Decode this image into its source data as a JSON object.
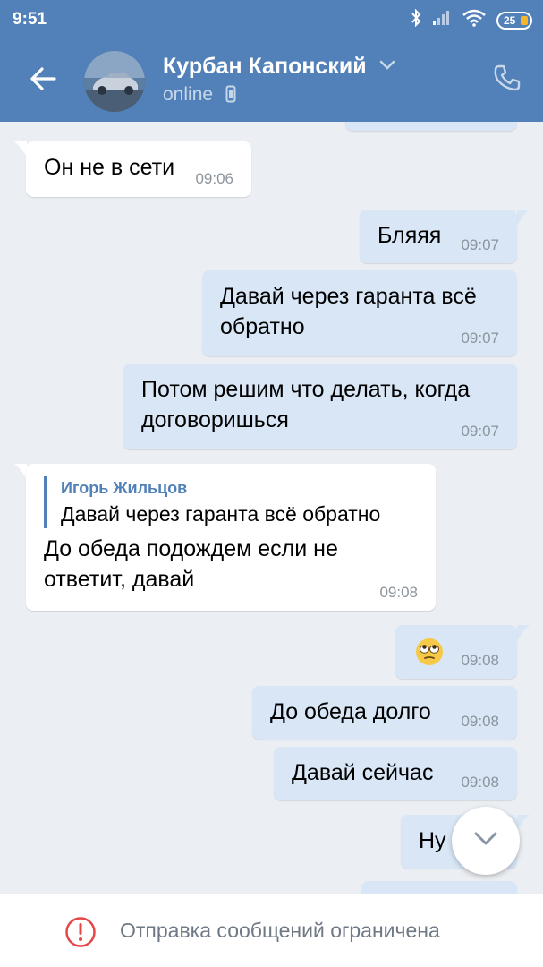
{
  "status_bar": {
    "time": "9:51",
    "battery": "25",
    "icons": [
      "bluetooth-icon",
      "signal-icon",
      "wifi-icon",
      "battery-icon"
    ]
  },
  "header": {
    "contact_name": "Курбан Капонский",
    "status": "online",
    "icons": [
      "back-arrow-icon",
      "chevron-down-icon",
      "mobile-icon",
      "phone-icon"
    ]
  },
  "messages": [
    {
      "direction": "in",
      "text": "Он не в сети",
      "time": "09:06"
    },
    {
      "direction": "out",
      "text": "Бляяя",
      "time": "09:07"
    },
    {
      "direction": "out",
      "text": "Давай через гаранта всё обратно",
      "time": "09:07"
    },
    {
      "direction": "out",
      "text": "Потом решим что делать, когда договоришься",
      "time": "09:07"
    },
    {
      "direction": "in",
      "reply_author": "Игорь Жильцов",
      "reply_text": "Давай через гаранта всё обратно",
      "text": "До обеда подождем если не ответит, давай",
      "time": "09:08"
    },
    {
      "direction": "out",
      "text": "🙄",
      "time": "09:08"
    },
    {
      "direction": "out",
      "text": "До обеда долго",
      "time": "09:08"
    },
    {
      "direction": "out",
      "text": "Давай сейчас",
      "time": "09:08"
    },
    {
      "direction": "out",
      "text": "Ну",
      "time": ""
    }
  ],
  "footer": {
    "notice": "Отправка сообщений ограничена"
  },
  "colors": {
    "header_bg": "#5181b8",
    "chat_bg": "#ebeef2",
    "incoming_bubble": "#ffffff",
    "outgoing_bubble": "#d8e6f6",
    "reply_accent": "#5181b8",
    "warning_red": "#e64646"
  }
}
